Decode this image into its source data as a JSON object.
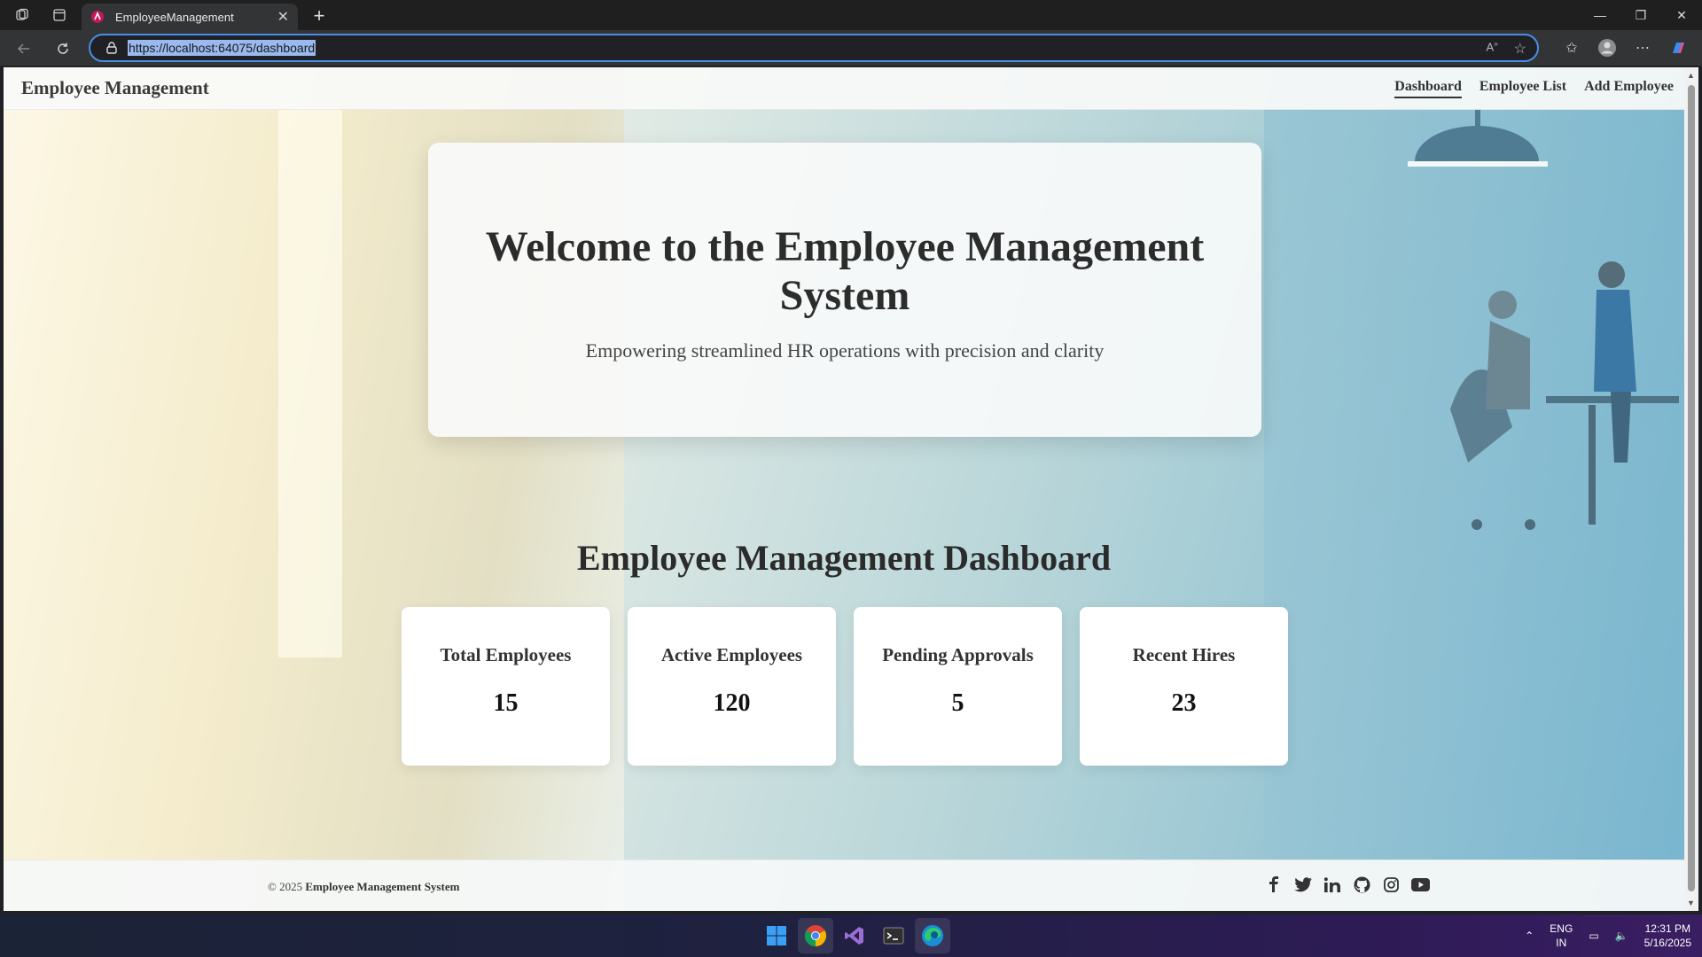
{
  "browser": {
    "tab_title": "EmployeeManagement",
    "url": "https://localhost:64075/dashboard"
  },
  "header": {
    "brand": "Employee Management",
    "nav": [
      {
        "label": "Dashboard",
        "active": true
      },
      {
        "label": "Employee List",
        "active": false
      },
      {
        "label": "Add Employee",
        "active": false
      }
    ]
  },
  "hero": {
    "title": "Welcome to the Employee Management System",
    "subtitle": "Empowering streamlined HR operations with precision and clarity"
  },
  "dashboard": {
    "title": "Employee Management Dashboard",
    "stats": [
      {
        "label": "Total Employees",
        "value": "15"
      },
      {
        "label": "Active Employees",
        "value": "120"
      },
      {
        "label": "Pending Approvals",
        "value": "5"
      },
      {
        "label": "Recent Hires",
        "value": "23"
      }
    ]
  },
  "footer": {
    "copyright_prefix": "© 2025",
    "copyright_name": "Employee Management System",
    "social_icons": [
      "facebook-icon",
      "twitter-icon",
      "linkedin-icon",
      "github-icon",
      "instagram-icon",
      "youtube-icon"
    ]
  },
  "taskbar": {
    "lang_line1": "ENG",
    "lang_line2": "IN",
    "time": "12:31 PM",
    "date": "5/16/2025"
  },
  "colors": {
    "accent_outline": "#4a8de8",
    "text_dark": "#2c2c2c"
  }
}
